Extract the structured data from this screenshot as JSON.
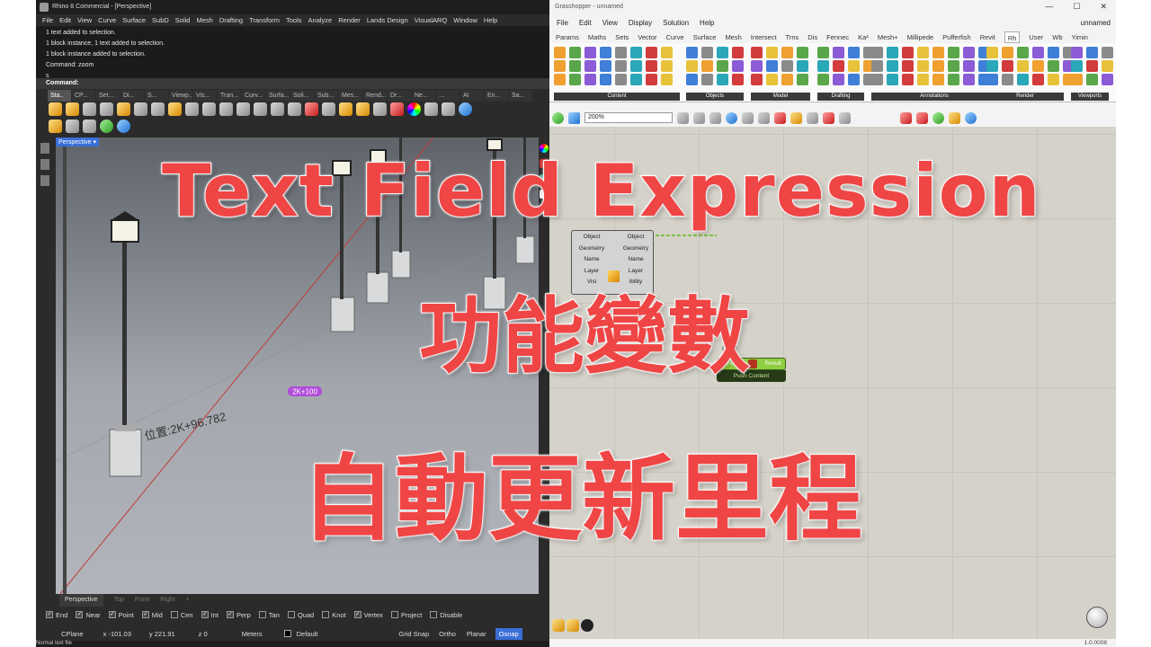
{
  "overlay": {
    "line1": "Text Field Expression",
    "line2": "功能變數",
    "line3": "自動更新里程"
  },
  "rhino": {
    "title": "Rhino 8 Commercial - [Perspective]",
    "menu": [
      "File",
      "Edit",
      "View",
      "Curve",
      "Surface",
      "SubD",
      "Solid",
      "Mesh",
      "Drafting",
      "Transform",
      "Tools",
      "Analyze",
      "Render",
      "Lands Design",
      "VisualARQ",
      "Window",
      "Help"
    ],
    "history": [
      "1 text added to selection.",
      "1 block instance, 1 text added to selection.",
      "1 block instance added to selection.",
      "Command: zoom",
      "s"
    ],
    "command_label": "Command:",
    "toolbar_tabs": [
      "Sta..",
      "CP...",
      "Set...",
      "Di...",
      "S...",
      "Viewp...",
      "Vis...",
      "Tran...",
      "Curv...",
      "Surfa...",
      "Soli...",
      "Sub...",
      "Mes...",
      "Rend...",
      "Dr...",
      "Ne...",
      "…",
      "AI",
      "En...",
      "Sa..."
    ],
    "viewport_label": "Perspective",
    "viewport_tag": "2K+100",
    "viewport_text": "位置:2K+96.782",
    "viewport_tabs": [
      "Perspective",
      "Top",
      "Front",
      "Right",
      "+"
    ],
    "osnap": [
      {
        "label": "End",
        "checked": true
      },
      {
        "label": "Near",
        "checked": true
      },
      {
        "label": "Point",
        "checked": true
      },
      {
        "label": "Mid",
        "checked": true
      },
      {
        "label": "Cen",
        "checked": false
      },
      {
        "label": "Int",
        "checked": true
      },
      {
        "label": "Perp",
        "checked": true
      },
      {
        "label": "Tan",
        "checked": false
      },
      {
        "label": "Quad",
        "checked": false
      },
      {
        "label": "Knot",
        "checked": false
      },
      {
        "label": "Vertex",
        "checked": true
      },
      {
        "label": "Project",
        "checked": false
      },
      {
        "label": "Disable",
        "checked": false
      }
    ],
    "status": {
      "cplane": "CPlane",
      "x": "x -101.03",
      "y": "y 221.91",
      "z": "z 0",
      "units": "Meters",
      "layer": "Default",
      "grid_snap": "Grid Snap",
      "ortho": "Ortho",
      "planar": "Planar",
      "osnap": "Osnap"
    },
    "footer": "Normal text file"
  },
  "grasshopper": {
    "title": "Grasshopper - unnamed",
    "menu": [
      "File",
      "Edit",
      "View",
      "Display",
      "Solution",
      "Help"
    ],
    "doc_name": "unnamed",
    "tabs": [
      "Params",
      "Maths",
      "Sets",
      "Vector",
      "Curve",
      "Surface",
      "Mesh",
      "Intersect",
      "Trns",
      "Dis",
      "Fennec",
      "Ka²",
      "Mesh+",
      "Millipede",
      "Pufferfish",
      "Revit",
      "Rh",
      "User",
      "Wb",
      "Yimin"
    ],
    "active_tab": "Rh",
    "groups": [
      "Content",
      "Objects",
      "Model",
      "Drafting",
      "Annotations",
      "Render",
      "Viewports"
    ],
    "zoom": "200%",
    "component": {
      "inputs": [
        "Object",
        "Geometry",
        "Name",
        "Layer",
        "Visi"
      ],
      "outputs": [
        "Object",
        "Geometry",
        "Name",
        "Layer",
        "ibility"
      ]
    },
    "push": {
      "cut_label": "Cont",
      "in": "Content",
      "out": "Result",
      "name": "Push Content"
    },
    "version": "1.0.0008"
  }
}
